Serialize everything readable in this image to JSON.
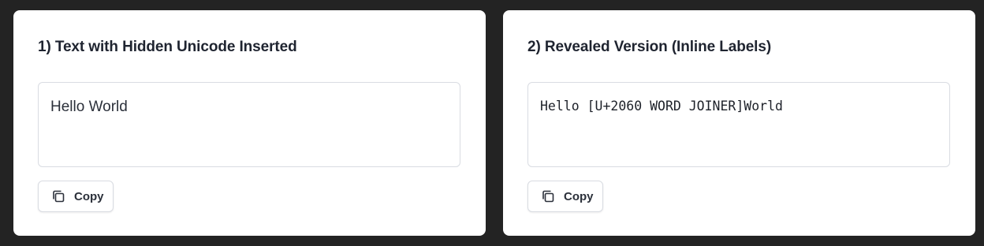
{
  "panels": [
    {
      "title": "1) Text with Hidden Unicode Inserted",
      "content": "Hello World",
      "copy_label": "Copy",
      "copy_icon": "copy-icon"
    },
    {
      "title": "2) Revealed Version (Inline Labels)",
      "content": "Hello [U+2060 WORD JOINER]World",
      "copy_label": "Copy",
      "copy_icon": "copy-icon"
    }
  ],
  "colors": {
    "background": "#232323",
    "panel": "#ffffff",
    "border": "#d9dce2",
    "text": "#1f2430"
  }
}
